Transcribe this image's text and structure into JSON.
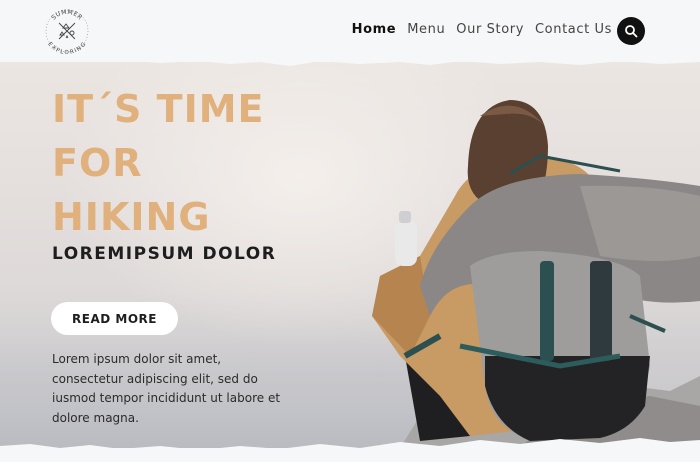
{
  "header": {
    "logo": {
      "top_text": "SUMMER",
      "bottom_text": "EXPLORING"
    },
    "nav": [
      {
        "label": "Home",
        "active": true
      },
      {
        "label": "Menu",
        "active": false
      },
      {
        "label": "Our Story",
        "active": false
      },
      {
        "label": "Contact Us",
        "active": false
      }
    ],
    "search_icon": "search-icon"
  },
  "hero": {
    "title_lines": [
      "IT´S TIME",
      "FOR",
      "HIKING"
    ],
    "subtitle": "LOREMIPSUM DOLOR",
    "button_label": "READ MORE",
    "text": "Lorem ipsum dolor sit amet, consectetur adipiscing elit, sed do iusmod tempor incididunt ut labore et dolore magna."
  },
  "colors": {
    "accent": "#e0b07d",
    "dark": "#1e1e1e",
    "header_bg": "#f6f7f9",
    "button_bg": "#ffffff"
  }
}
